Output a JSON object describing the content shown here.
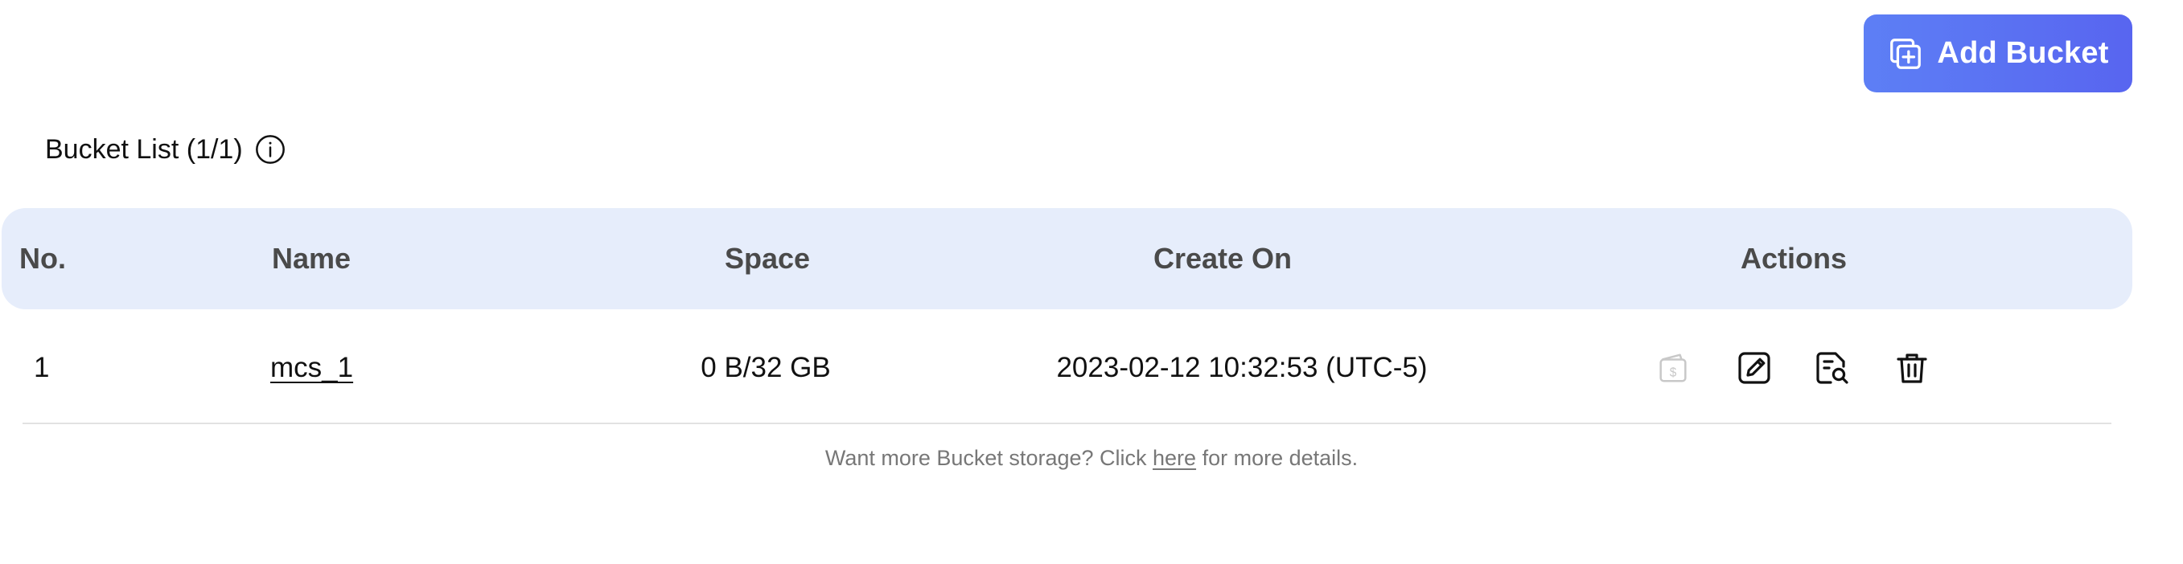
{
  "toolbar": {
    "add_bucket_label": "Add Bucket",
    "add_bucket_icon": "add-copy-icon"
  },
  "section": {
    "title": "Bucket List (1/1)",
    "info_icon": "info-icon"
  },
  "table": {
    "columns": [
      "No.",
      "Name",
      "Space",
      "Create On",
      "Actions"
    ],
    "rows": [
      {
        "no": "1",
        "name": "mcs_1",
        "space": "0 B/32 GB",
        "created_on": "2023-02-12 10:32:53 (UTC-5)",
        "actions": [
          {
            "name": "billing-icon",
            "enabled": false
          },
          {
            "name": "edit-icon",
            "enabled": true
          },
          {
            "name": "file-search-icon",
            "enabled": true
          },
          {
            "name": "delete-icon",
            "enabled": true
          }
        ]
      }
    ]
  },
  "footer": {
    "before": "Want more Bucket storage? Click ",
    "link": "here",
    "after": " for more details."
  },
  "colors": {
    "accent_start": "#5d7ff5",
    "accent_end": "#5865f0",
    "header_bg": "#e6edfb",
    "disabled_icon": "#c8c8c8"
  }
}
